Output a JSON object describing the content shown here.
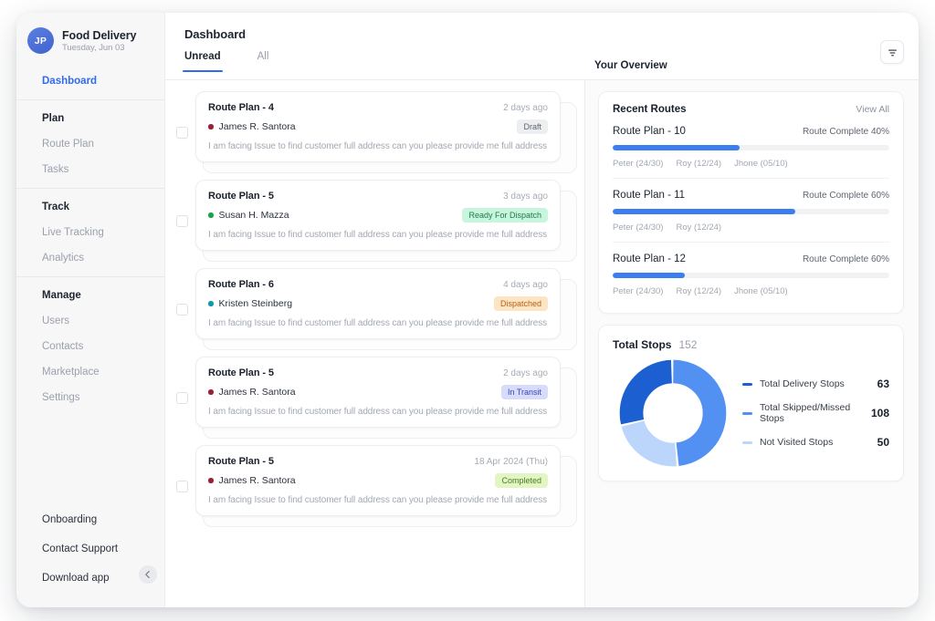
{
  "brand": {
    "initials": "JP",
    "title": "Food Delivery",
    "date": "Tuesday, Jun 03"
  },
  "sidebar": {
    "top": [
      {
        "label": "Dashboard",
        "active": true
      }
    ],
    "groups": [
      {
        "head": "Plan",
        "items": [
          "Route Plan",
          "Tasks"
        ]
      },
      {
        "head": "Track",
        "items": [
          "Live Tracking",
          "Analytics"
        ]
      },
      {
        "head": "Manage",
        "items": [
          "Users",
          "Contacts",
          "Marketplace",
          "Settings"
        ]
      }
    ],
    "bottom": [
      "Onboarding",
      "Contact Support",
      "Download app"
    ],
    "collapse_icon": "arrow-left-icon"
  },
  "header": {
    "page_title": "Dashboard",
    "tabs": [
      {
        "label": "Unread",
        "active": true
      },
      {
        "label": "All",
        "active": false
      }
    ],
    "overview_title": "Your Overview",
    "filter_icon": "filter-icon"
  },
  "messages": [
    {
      "title": "Route Plan - 4",
      "time": "2 days ago",
      "person": "James R. Santora",
      "dot_color": "#9b2033",
      "badge": "Draft",
      "badge_bg": "#eceef0",
      "badge_fg": "#5f6570",
      "text": "I am facing Issue to find customer full address can you please provide me full address"
    },
    {
      "title": "Route Plan - 5",
      "time": "3 days ago",
      "person": "Susan H. Mazza",
      "dot_color": "#16a34a",
      "badge": "Ready For Dispatch",
      "badge_bg": "#c8f5dd",
      "badge_fg": "#1f7a4d",
      "text": "I am facing Issue to find customer full address can you please provide me full address"
    },
    {
      "title": "Route Plan - 6",
      "time": "4 days ago",
      "person": "Kristen Steinberg",
      "dot_color": "#0e9aa7",
      "badge": "Dispatched",
      "badge_bg": "#fde4c3",
      "badge_fg": "#b4621b",
      "text": "I am facing Issue to find customer full address can you please provide me full address"
    },
    {
      "title": "Route Plan - 5",
      "time": "2 days ago",
      "person": "James R. Santora",
      "dot_color": "#9b2033",
      "badge": "In Transit",
      "badge_bg": "#d7dcfb",
      "badge_fg": "#3b45b8",
      "text": "I am facing Issue to find customer full address can you please provide me full address"
    },
    {
      "title": "Route Plan - 5",
      "time": "18 Apr 2024 (Thu)",
      "person": "James R. Santora",
      "dot_color": "#9b2033",
      "badge": "Completed",
      "badge_bg": "#e2f6c4",
      "badge_fg": "#4d7a1f",
      "text": "I am facing Issue to find customer full address can you please provide me full address"
    }
  ],
  "recent_routes": {
    "title": "Recent Routes",
    "view_all": "View All",
    "rows": [
      {
        "name": "Route Plan - 10",
        "pct_label": "Route Complete 40%",
        "fill_pct": 46,
        "drivers": [
          "Peter (24/30)",
          "Roy (12/24)",
          "Jhone (05/10)"
        ]
      },
      {
        "name": "Route Plan - 11",
        "pct_label": "Route Complete 60%",
        "fill_pct": 66,
        "drivers": [
          "Peter (24/30)",
          "Roy (12/24)"
        ]
      },
      {
        "name": "Route Plan - 12",
        "pct_label": "Route Complete 60%",
        "fill_pct": 26,
        "drivers": [
          "Peter (24/30)",
          "Roy (12/24)",
          "Jhone (05/10)"
        ]
      }
    ]
  },
  "total_stops": {
    "title": "Total Stops",
    "total": "152"
  },
  "chart_data": {
    "type": "pie",
    "title": "Total Stops",
    "total": 152,
    "categories": [
      "Total Delivery Stops",
      "Total Skipped/Missed Stops",
      "Not Visited Stops"
    ],
    "values": [
      63,
      108,
      50
    ],
    "colors": [
      "#1b5fd0",
      "#5290f2",
      "#bcd5fb"
    ],
    "legend": "right",
    "donut": true
  }
}
